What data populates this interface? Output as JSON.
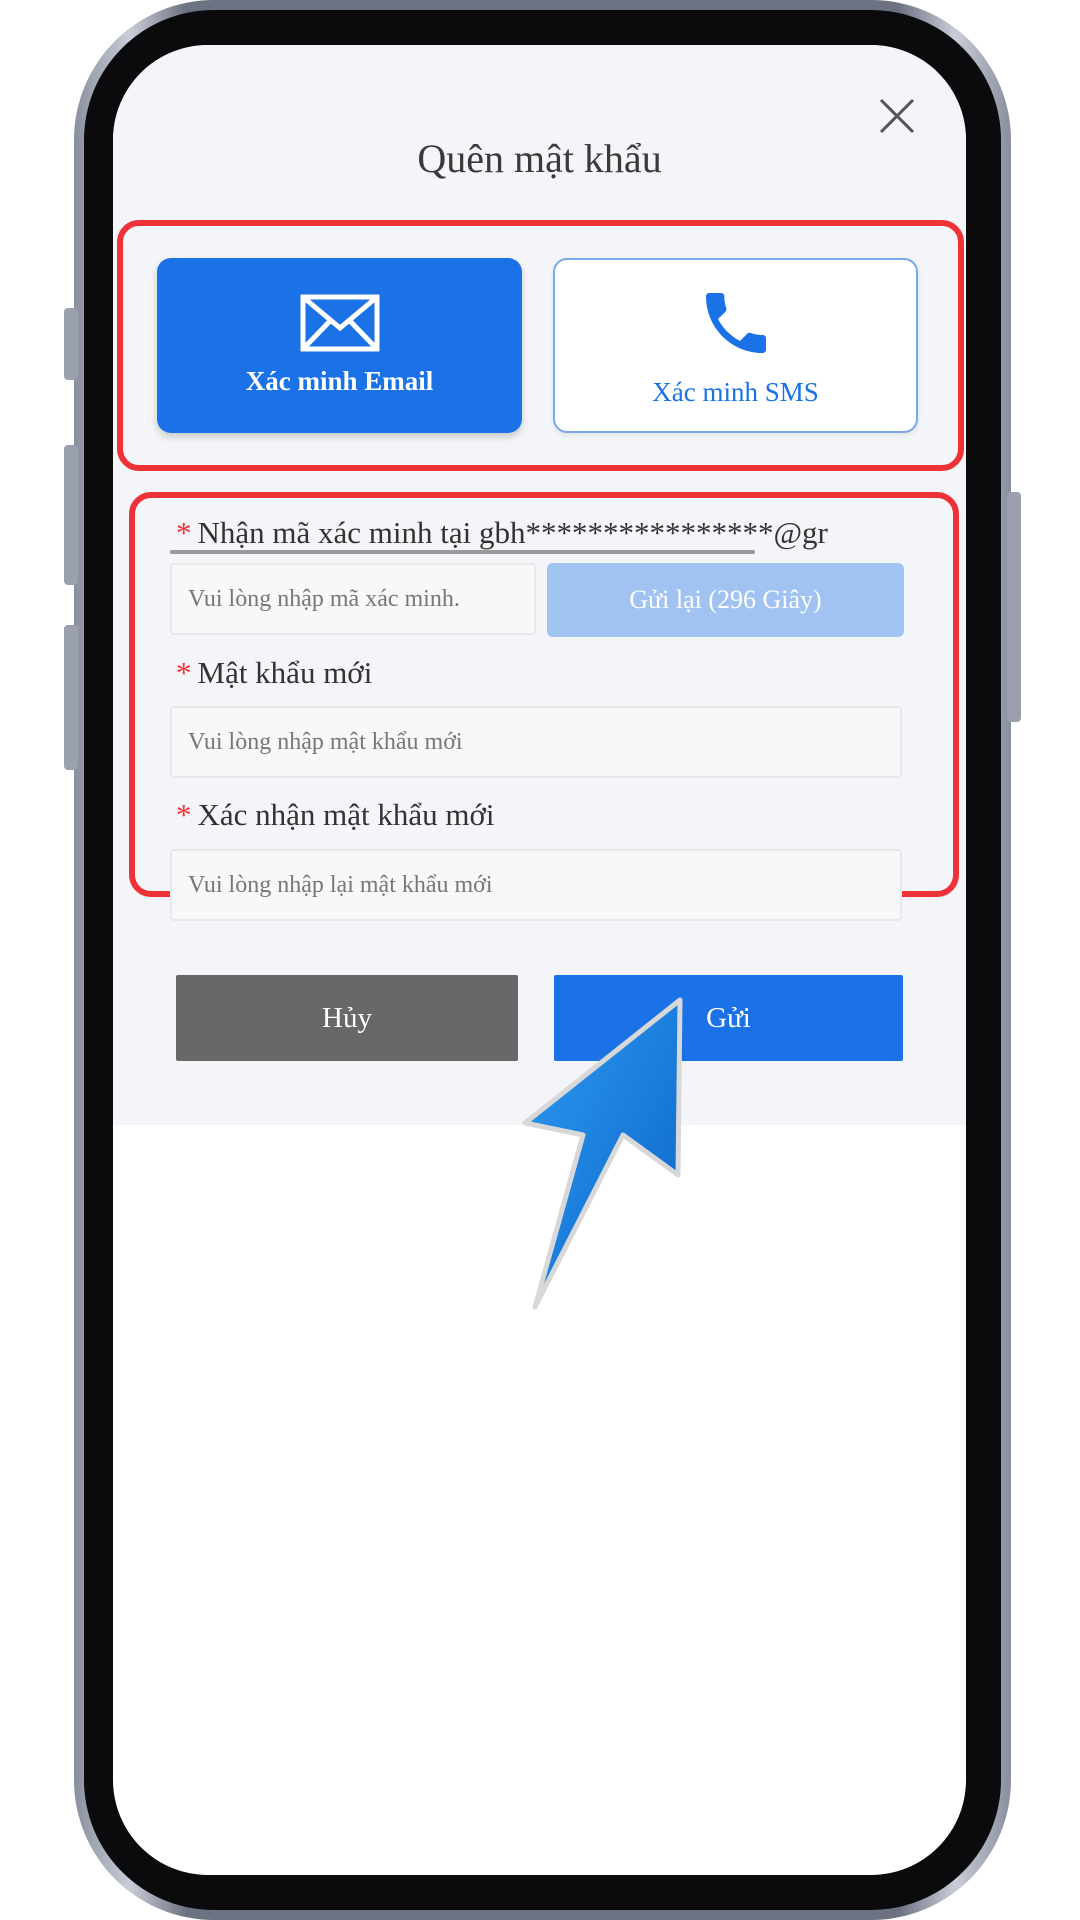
{
  "dialog": {
    "title": "Quên mật khẩu"
  },
  "methods": {
    "email": {
      "label": "Xác minh Email",
      "icon": "mail-icon",
      "selected": true
    },
    "sms": {
      "label": "Xác minh SMS",
      "icon": "phone-icon",
      "selected": false
    }
  },
  "form": {
    "code": {
      "label": "Nhận mã xác minh tại gbh****************@gr",
      "placeholder": "Vui lòng nhập mã xác minh.",
      "value": "",
      "resend_label": "Gửi lại (296 Giây)"
    },
    "new_password": {
      "label": "Mật khẩu mới",
      "placeholder": "Vui lòng nhập mật khẩu mới",
      "value": ""
    },
    "confirm_password": {
      "label": "Xác nhận mật khẩu mới",
      "placeholder": "Vui lòng nhập lại mật khẩu mới",
      "value": ""
    },
    "required_mark": "*"
  },
  "actions": {
    "cancel_label": "Hủy",
    "submit_label": "Gửi"
  },
  "colors": {
    "primary": "#1a72e6",
    "primary_disabled": "#a0c3f2",
    "cancel": "#686868",
    "highlight": "#ee3338",
    "dialog_bg": "#f3f5f8"
  }
}
